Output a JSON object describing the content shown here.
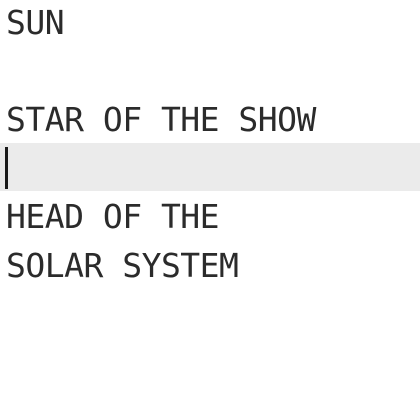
{
  "editor": {
    "lines": [
      "SUN",
      "",
      "STAR OF THE SHOW",
      "",
      "HEAD OF THE",
      "SOLAR SYSTEM"
    ],
    "current_line_highlight": "#ebebeb",
    "text_color": "#2b2b2b"
  }
}
